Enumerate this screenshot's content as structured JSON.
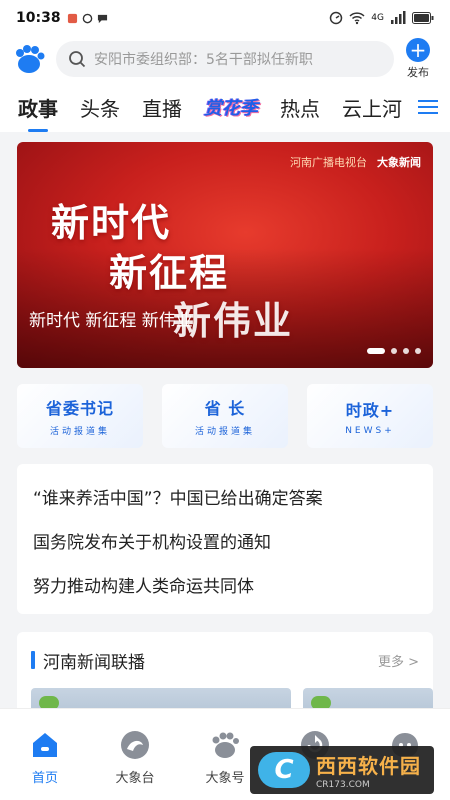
{
  "status_bar": {
    "time": "10:38",
    "network": "4G"
  },
  "top_bar": {
    "search_placeholder": "安阳市委组织部：5名干部拟任新职",
    "publish_label": "发布"
  },
  "tabs": [
    {
      "label": "政事",
      "active": true
    },
    {
      "label": "头条"
    },
    {
      "label": "直播"
    },
    {
      "label": "赏花季",
      "special": true
    },
    {
      "label": "热点"
    },
    {
      "label": "云上河"
    }
  ],
  "banner": {
    "headline_lines": [
      "新时代",
      "新征程",
      "新伟业"
    ],
    "caption": "新时代 新征程 新伟业",
    "brand_1": "河南广播电视台",
    "brand_2": "大象新闻",
    "slide_count": 4,
    "active_slide": 0
  },
  "quick_cards": [
    {
      "title": "省委书记",
      "subtitle": "活动报道集"
    },
    {
      "title": "省 长",
      "subtitle": "活动报道集"
    },
    {
      "title": "时政+",
      "subtitle": "NEWS+"
    }
  ],
  "news_list": [
    "“谁来养活中国”？中国已给出确定答案",
    "国务院发布关于机构设置的通知",
    "努力推动构建人类命运共同体"
  ],
  "section": {
    "title": "河南新闻联播",
    "more_label": "更多 >"
  },
  "bottom_nav": [
    {
      "label": "首页",
      "icon": "home-icon",
      "active": true
    },
    {
      "label": "大象台",
      "icon": "swirl-icon"
    },
    {
      "label": "大象号",
      "icon": "paw-icon"
    },
    {
      "label": "",
      "icon": "refresh-icon"
    },
    {
      "label": "",
      "icon": "face-icon"
    }
  ],
  "watermark": {
    "logo_text": "C",
    "main": "西西软件园",
    "sub": "CR173.COM"
  },
  "colors": {
    "accent": "#1e7cf2",
    "banner_red": "#c8201d"
  }
}
